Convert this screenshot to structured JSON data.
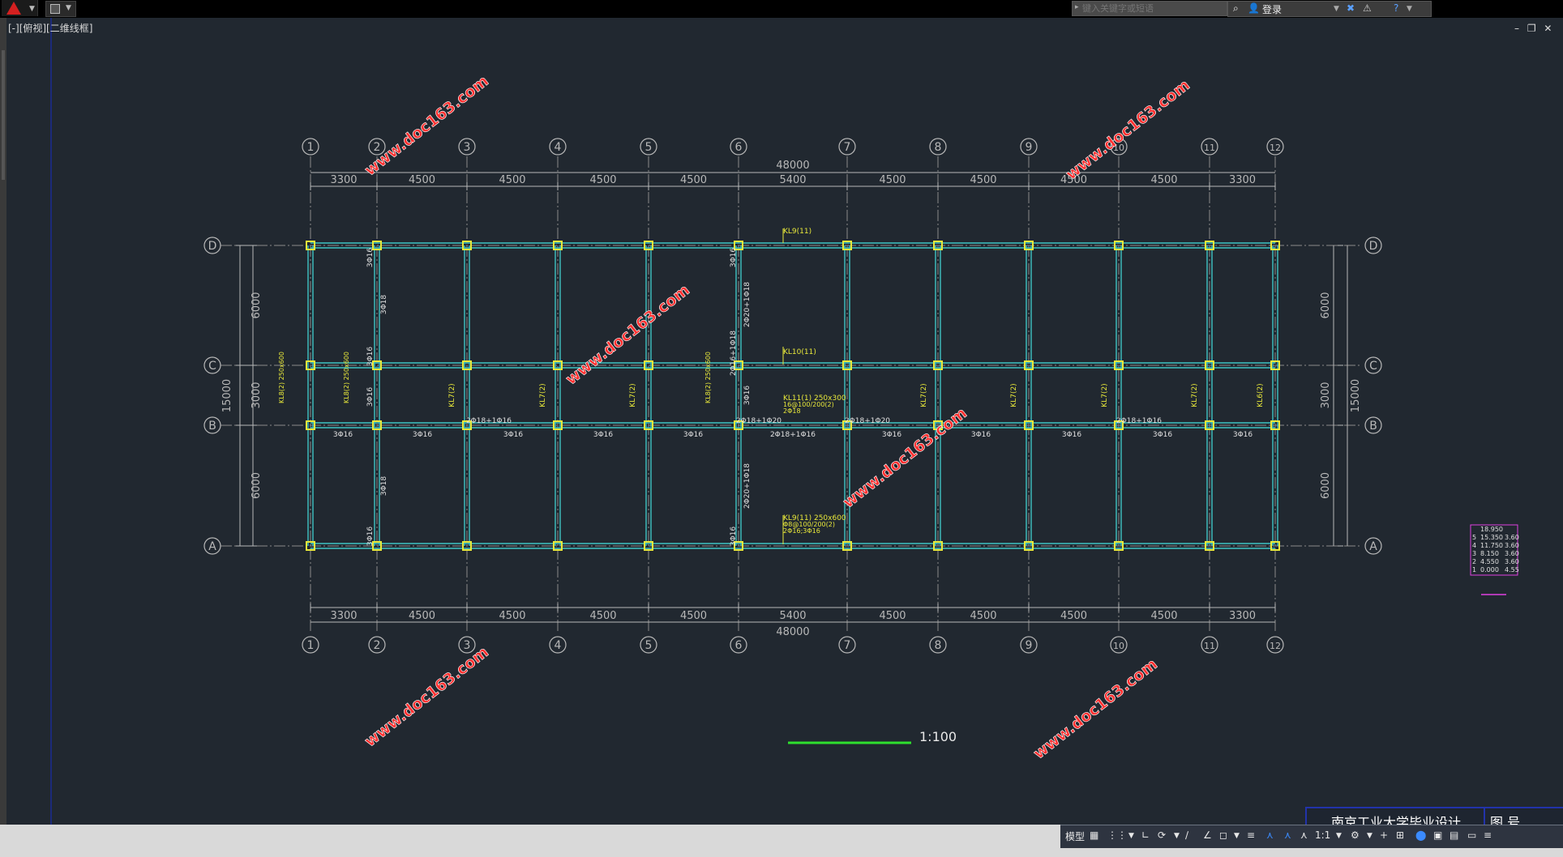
{
  "app": {
    "search_placeholder": "键入关键字或短语",
    "login_label": "登录",
    "viewport_label": "[-][俯视][二维线框]",
    "window_controls": [
      "–",
      "❐",
      "✕"
    ]
  },
  "drawing": {
    "grid_cols": [
      "1",
      "2",
      "3",
      "4",
      "5",
      "6",
      "7",
      "8",
      "9",
      "10",
      "11",
      "12"
    ],
    "grid_rows": [
      "D",
      "C",
      "B",
      "A"
    ],
    "col_spacings": [
      "3300",
      "4500",
      "4500",
      "4500",
      "4500",
      "5400",
      "4500",
      "4500",
      "4500",
      "4500",
      "3300"
    ],
    "total_width": "48000",
    "row_spacings": [
      "6000",
      "3000",
      "6000"
    ],
    "total_height": "15000",
    "scale_label": "1:100",
    "watermark": "www.doc163.com",
    "beam_labels": {
      "kl9_top": "KL9(11)",
      "kl10": "KL10(11)",
      "kl11": "KL11(1) 250x300",
      "kl11_sub": "16@100/200(2)",
      "kl11_sub2": "2Φ18",
      "kl9_bottom": "KL9(11) 250x600",
      "kl9_bottom_sub": "Φ8@100/200(2)",
      "kl9_bottom_sub2": "2Φ16;3Φ16",
      "kl7": "KL7(2)",
      "kl6": "KL6(2)",
      "kl8": "KL8(2) 250x600",
      "left_beam": "KL8(2) 250x600"
    },
    "rebar_labels": {
      "r3116": "3Φ16",
      "r3118": "3Φ18",
      "r2120": "2Φ20+1Φ18",
      "r2118_1720": "2Φ18+1Φ20",
      "r2118_1716": "2Φ18+1Φ16",
      "r2116_1718": "2Φ16+1Φ18"
    },
    "elevation_table": [
      {
        "floor": "",
        "elev": "18.950",
        "h": ""
      },
      {
        "floor": "5",
        "elev": "15.350",
        "h": "3.60"
      },
      {
        "floor": "4",
        "elev": "11.750",
        "h": "3.60"
      },
      {
        "floor": "3",
        "elev": "8.150",
        "h": "3.60"
      },
      {
        "floor": "2",
        "elev": "4.550",
        "h": "3.60"
      },
      {
        "floor": "1",
        "elev": "0.000",
        "h": "4.55"
      }
    ],
    "title_block_text": "南京工业大学毕业设计",
    "title_block_right": "图  号"
  },
  "statusbar": {
    "model_label": "模型",
    "scale_value": "1:1"
  }
}
